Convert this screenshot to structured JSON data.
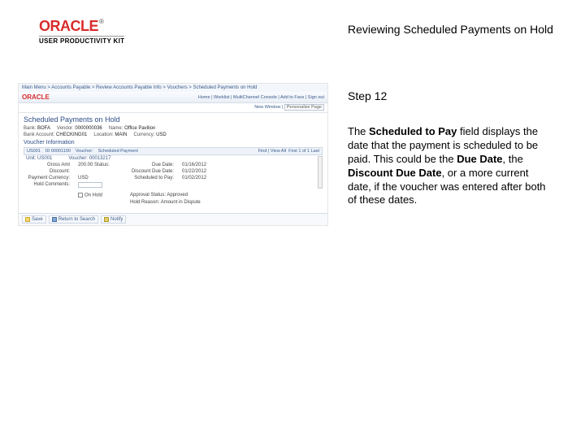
{
  "logo": {
    "word": "ORACLE",
    "tm": "®",
    "sub": "USER PRODUCTIVITY KIT"
  },
  "title": "Reviewing Scheduled Payments on Hold",
  "step": "Step 12",
  "description": {
    "t1": "The ",
    "b1": "Scheduled to Pay",
    "t2": " field displays the date that the payment is scheduled to be paid. This could be the ",
    "b2": "Due Date",
    "t3": ", the ",
    "b3": "Discount Due Date",
    "t4": ", or a more current date, if the voucher was entered after both of these dates."
  },
  "ss": {
    "breadcrumb": "Main Menu > Accounts Payable > Review Accounts Payable Info > Vouchers > Scheduled Payments on Hold",
    "logo": "ORACLE",
    "hdr_links": "Home | Worklist | MultiChannel Console | Add to Favs | Sign out",
    "toolbar_new": "New Window",
    "toolbar_personalize": "Personalize Page",
    "page_title": "Scheduled Payments on Hold",
    "r1": {
      "bank_l": "Bank:",
      "bank_v": "BOFA",
      "vendor_l": "Vendor:",
      "vendor_v": "0000000036",
      "name_l": "Name:",
      "name_v": "Office Pavilion"
    },
    "r2": {
      "acct_l": "Bank Account:",
      "acct_v": "CHECKING01",
      "loc_l": "Location:",
      "loc_v": "MAIN",
      "cur_l": "Currency:",
      "cur_v": "USD"
    },
    "section": "Voucher Information",
    "grid": {
      "unit": "US001",
      "id": "00001190",
      "id_lbl": "ID",
      "vch": "Voucher:",
      "sched_lbl": "Scheduled Payment",
      "view": "Find | View All",
      "nav": "First 1 of 1 Last"
    },
    "sub": {
      "unit_l": "Unit:",
      "unit_v": "US001",
      "vch_l": "Voucher:",
      "vch_v": "00013217"
    },
    "f": {
      "gross_l": "Gross Amt",
      "gross_v": "200.00",
      "stat_l": "Status:",
      "due_l": "Due Date:",
      "due_v": "01/16/2012",
      "disc_l": "Discount:",
      "ddue_l": "Discount Due Date:",
      "ddue_v": "01/22/2012",
      "pay_l": "Payment Currency:",
      "pay_v": "USD",
      "spay_l": "Scheduled to Pay:",
      "spay_v": "01/02/2012",
      "hold_l": "Hold Comments:",
      "on_hold": "On Hold",
      "approved": "Approval Status: Approved",
      "hreason": "Hold Reason: Amount in Dispute"
    },
    "btn": {
      "save": "Save",
      "ret": "Return to Search",
      "notify": "Notify"
    }
  }
}
